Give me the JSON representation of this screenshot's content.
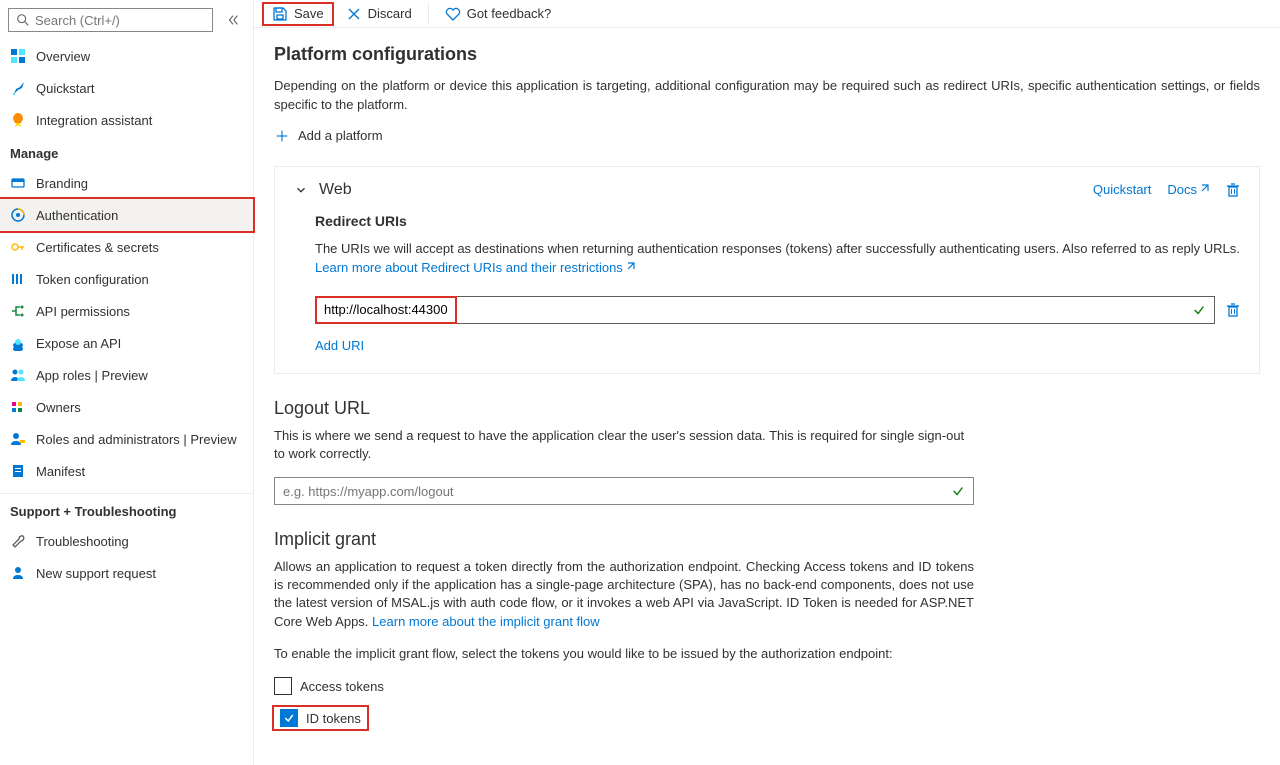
{
  "sidebar": {
    "search_placeholder": "Search (Ctrl+/)",
    "items_top": [
      {
        "label": "Overview"
      },
      {
        "label": "Quickstart"
      },
      {
        "label": "Integration assistant"
      }
    ],
    "group_manage": "Manage",
    "items_manage": [
      {
        "label": "Branding"
      },
      {
        "label": "Authentication"
      },
      {
        "label": "Certificates & secrets"
      },
      {
        "label": "Token configuration"
      },
      {
        "label": "API permissions"
      },
      {
        "label": "Expose an API"
      },
      {
        "label": "App roles | Preview"
      },
      {
        "label": "Owners"
      },
      {
        "label": "Roles and administrators | Preview"
      },
      {
        "label": "Manifest"
      }
    ],
    "group_support": "Support + Troubleshooting",
    "items_support": [
      {
        "label": "Troubleshooting"
      },
      {
        "label": "New support request"
      }
    ]
  },
  "toolbar": {
    "save": "Save",
    "discard": "Discard",
    "feedback": "Got feedback?"
  },
  "main": {
    "platform_title": "Platform configurations",
    "platform_desc": "Depending on the platform or device this application is targeting, additional configuration may be required such as redirect URIs, specific authentication settings, or fields specific to the platform.",
    "add_platform": "Add a platform",
    "web": {
      "title": "Web",
      "quickstart": "Quickstart",
      "docs": "Docs",
      "redirect_title": "Redirect URIs",
      "redirect_desc": "The URIs we will accept as destinations when returning authentication responses (tokens) after successfully authenticating users. Also referred to as reply URLs. ",
      "redirect_learn": "Learn more about Redirect URIs and their restrictions",
      "uri_value": "http://localhost:44300",
      "add_uri": "Add URI"
    },
    "logout": {
      "title": "Logout URL",
      "desc": "This is where we send a request to have the application clear the user's session data. This is required for single sign-out to work correctly.",
      "placeholder": "e.g. https://myapp.com/logout"
    },
    "implicit": {
      "title": "Implicit grant",
      "desc": "Allows an application to request a token directly from the authorization endpoint. Checking Access tokens and ID tokens is recommended only if the application has a single-page architecture (SPA), has no back-end components, does not use the latest version of MSAL.js with auth code flow, or it invokes a web API via JavaScript. ID Token is needed for ASP.NET Core Web Apps. ",
      "learn": "Learn more about the implicit grant flow",
      "enable_desc": "To enable the implicit grant flow, select the tokens you would like to be issued by the authorization endpoint:",
      "access_tokens": "Access tokens",
      "id_tokens": "ID tokens"
    }
  }
}
